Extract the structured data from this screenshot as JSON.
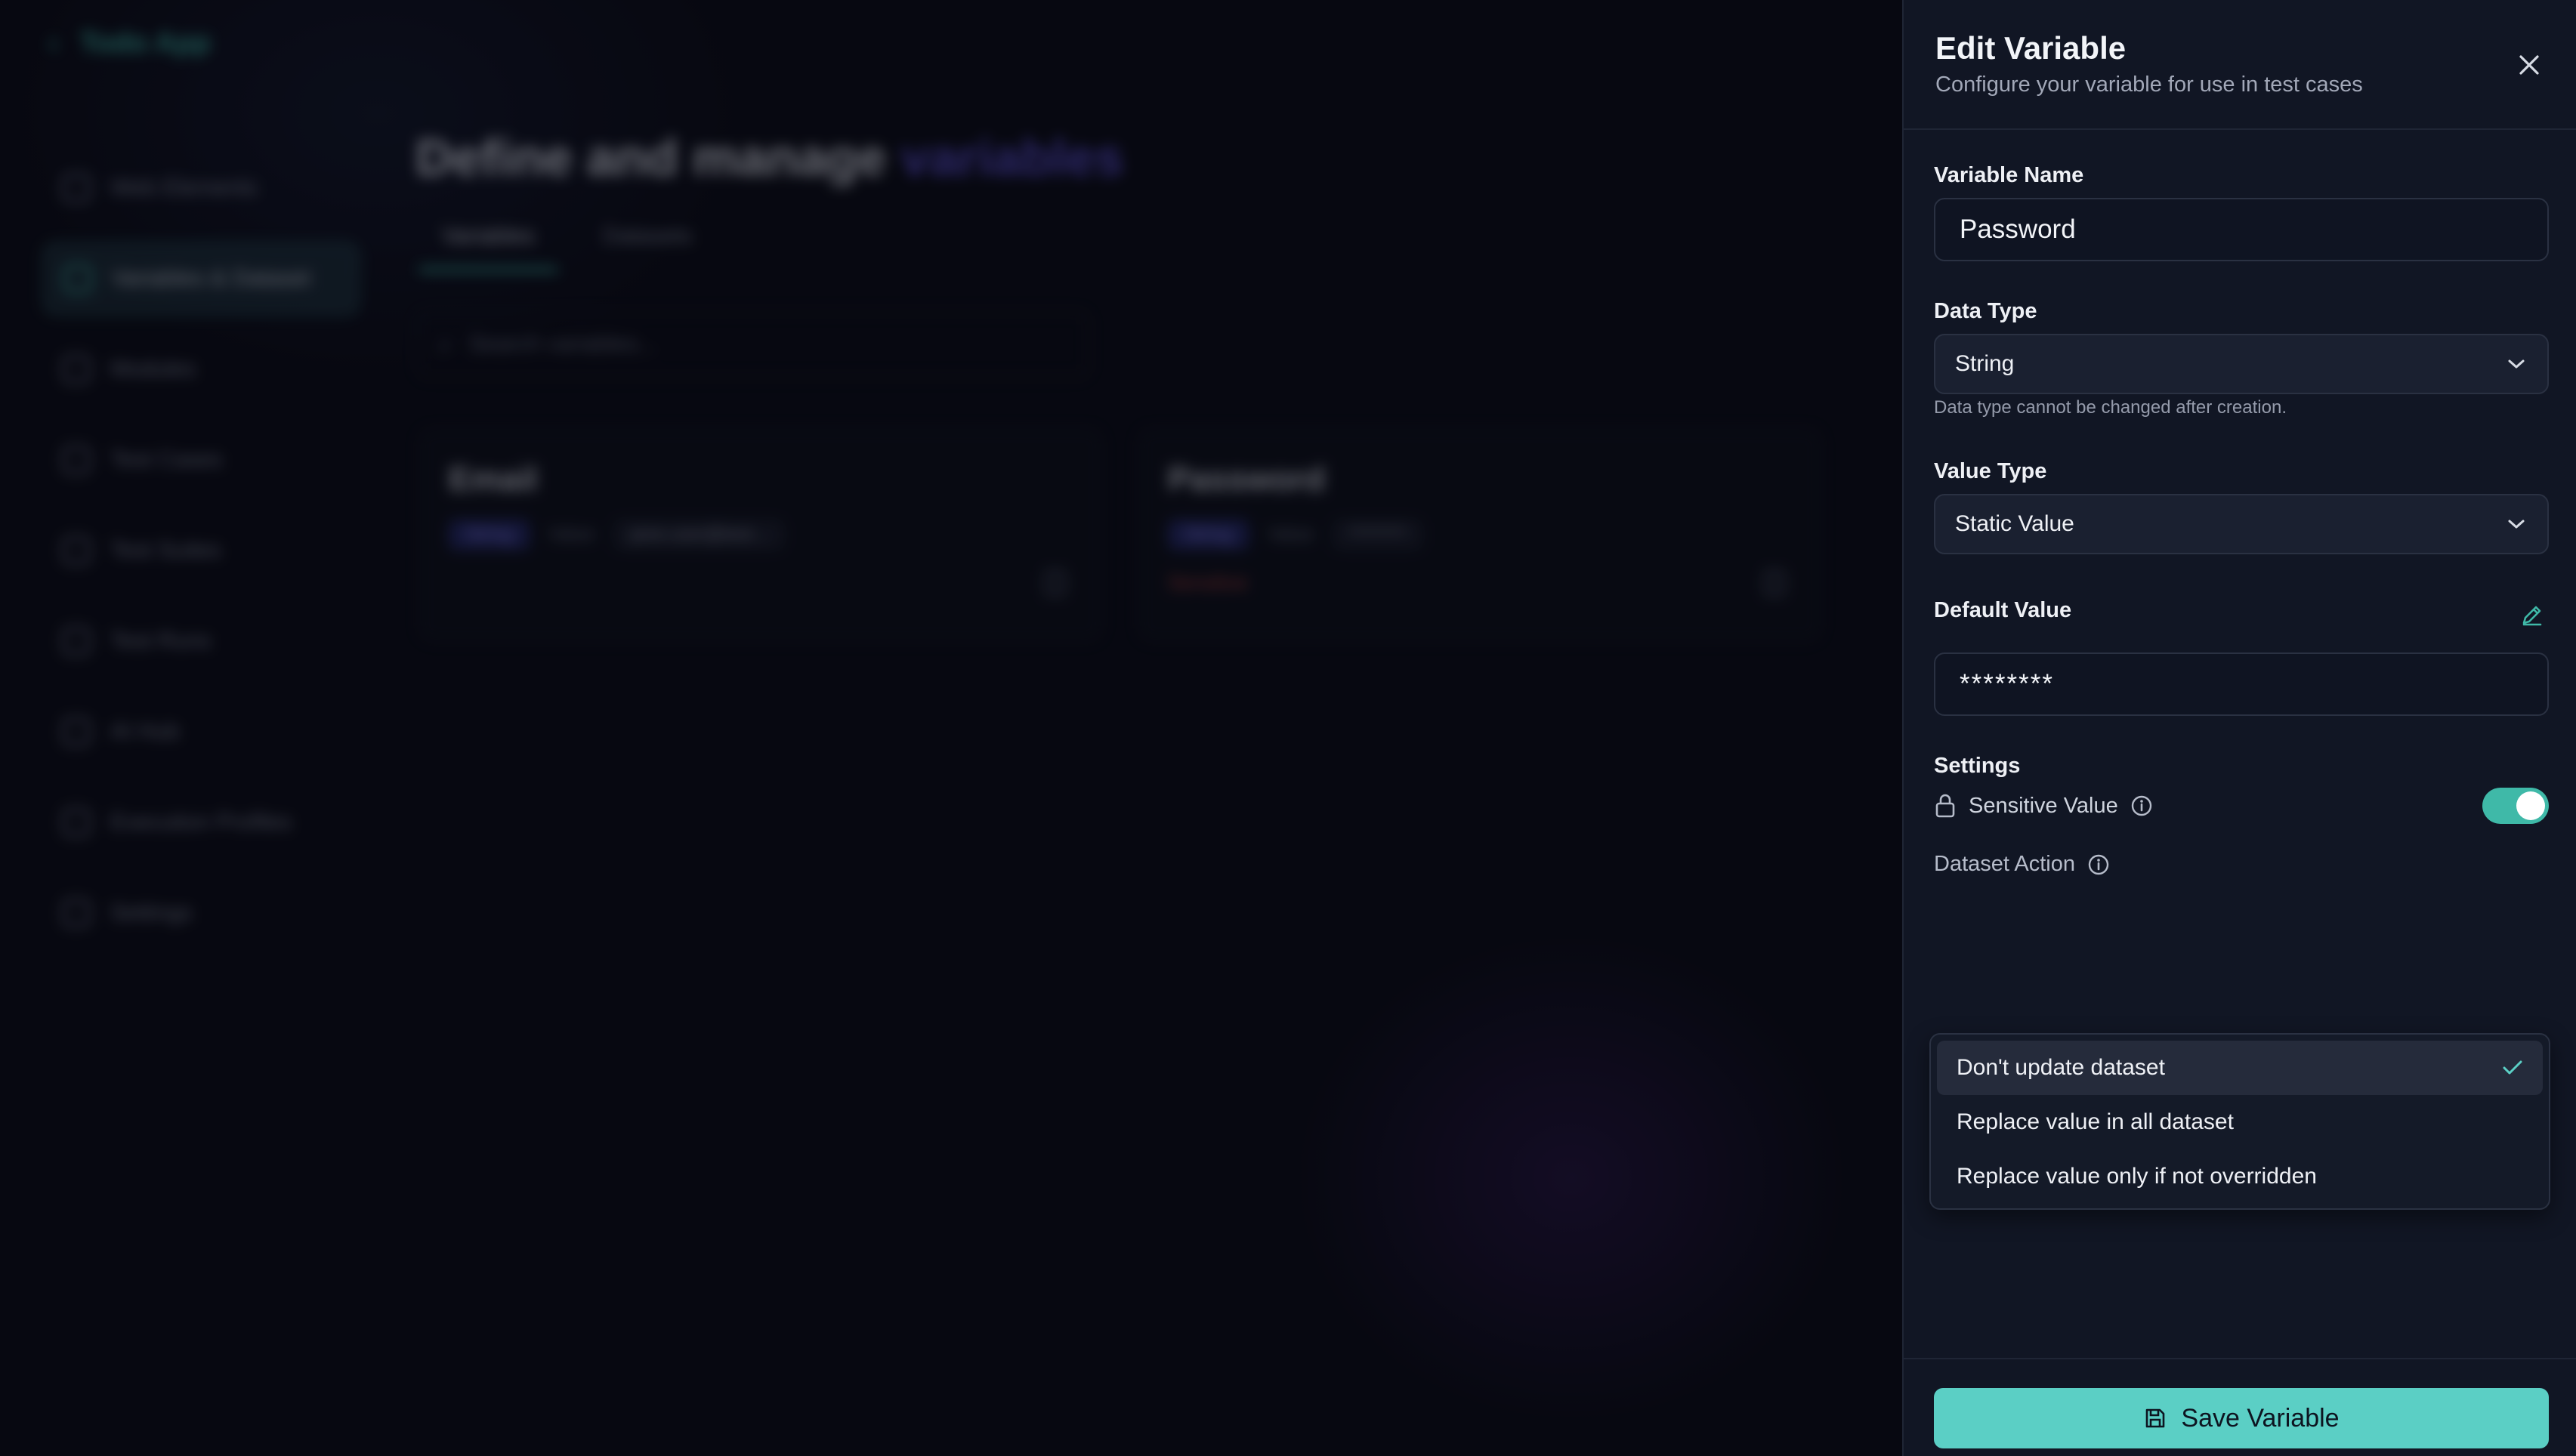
{
  "background": {
    "app_title": "Todo App",
    "nav_items": [
      {
        "label": "Web Elements"
      },
      {
        "label": "Variables & Dataset"
      },
      {
        "label": "Modules"
      },
      {
        "label": "Test Cases"
      },
      {
        "label": "Test Suites"
      },
      {
        "label": "Test Runs"
      },
      {
        "label": "AI Hub"
      },
      {
        "label": "Execution Profiles"
      },
      {
        "label": "Settings"
      }
    ],
    "page_title": "Define and manage",
    "page_title_accent": "variables",
    "tabs": [
      "Variables",
      "Datasets"
    ],
    "search_placeholder": "Search variables...",
    "cards": [
      {
        "name": "Email",
        "type": "String",
        "value_label": "Value",
        "value": "jane.user@test...",
        "sensitive": ""
      },
      {
        "name": "Password",
        "type": "String",
        "value_label": "Value",
        "value": "********",
        "sensitive": "Sensitive"
      }
    ]
  },
  "panel": {
    "title": "Edit Variable",
    "subtitle": "Configure your variable for use in test cases",
    "variable_name_label": "Variable Name",
    "variable_name_value": "Password",
    "data_type_label": "Data Type",
    "data_type_value": "String",
    "data_type_helper": "Data type cannot be changed after creation.",
    "value_type_label": "Value Type",
    "value_type_value": "Static Value",
    "default_value_label": "Default Value",
    "default_value": "********",
    "settings_label": "Settings",
    "sensitive_label": "Sensitive Value",
    "sensitive_enabled": true,
    "dataset_action_label": "Dataset Action",
    "dataset_options": [
      {
        "label": "Don't update dataset",
        "selected": true
      },
      {
        "label": "Replace value in all dataset",
        "selected": false
      },
      {
        "label": "Replace value only if not overridden",
        "selected": false
      }
    ],
    "save_label": "Save Variable"
  },
  "colors": {
    "accent": "#3fb9a8",
    "save_button": "#5bcfc5",
    "panel_bg": "#111624"
  }
}
